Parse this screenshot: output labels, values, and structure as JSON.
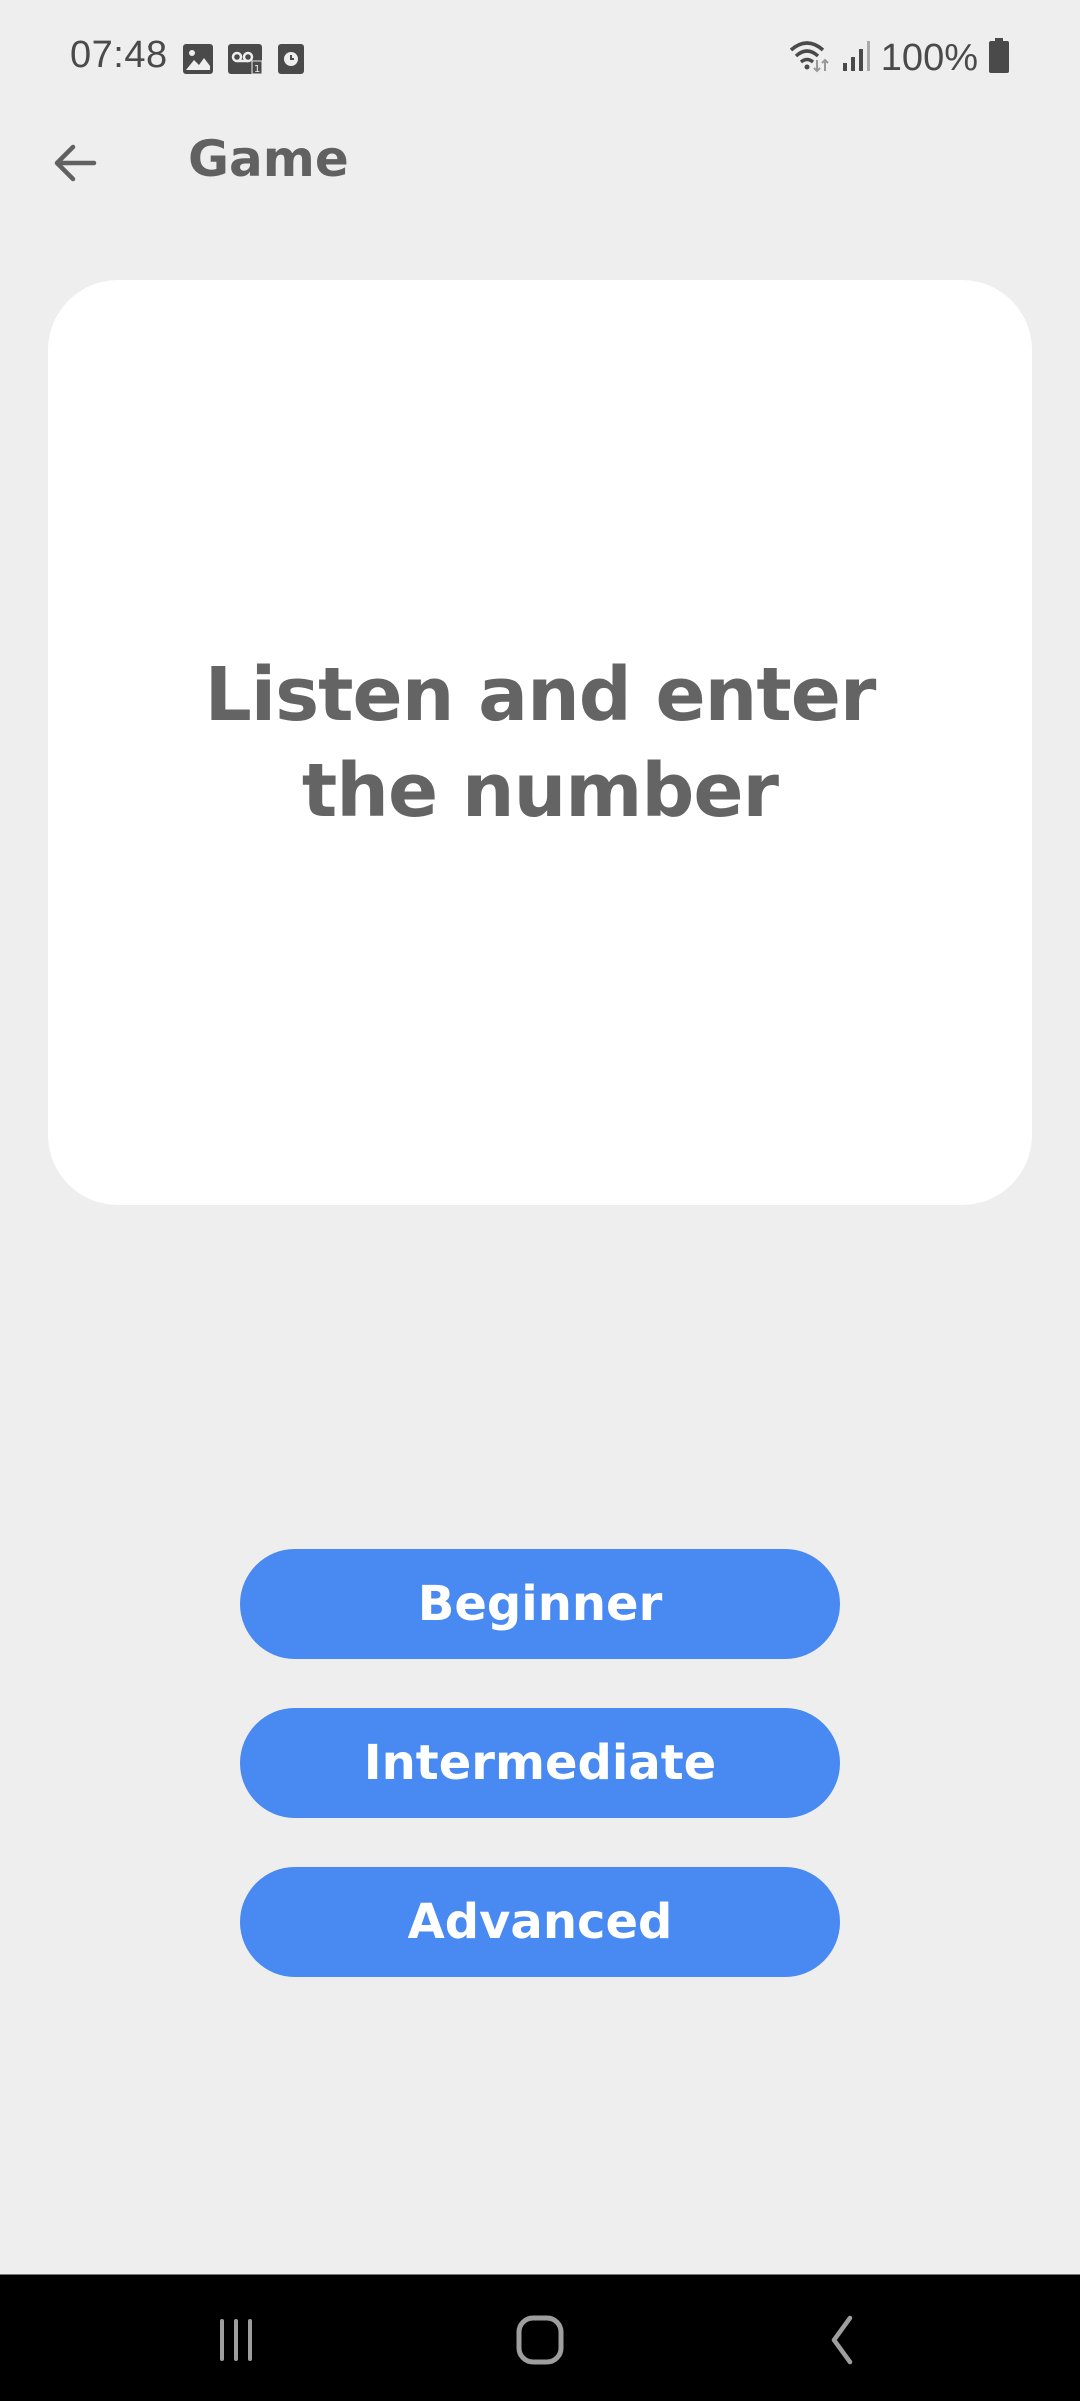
{
  "status_bar": {
    "time": "07:48",
    "notification_icons": [
      "image-icon",
      "voicemail-icon",
      "clock-icon"
    ],
    "voicemail_badge": "1",
    "battery_percent": "100%",
    "system_icons": [
      "wifi-icon",
      "signal-icon",
      "battery-icon"
    ]
  },
  "app_bar": {
    "title": "Game",
    "back_icon": "arrow-left-icon"
  },
  "card": {
    "instruction": "Listen and enter the number"
  },
  "levels": [
    {
      "label": "Beginner"
    },
    {
      "label": "Intermediate"
    },
    {
      "label": "Advanced"
    }
  ],
  "colors": {
    "background": "#eeeeee",
    "card": "#ffffff",
    "accent": "#4889f2",
    "text": "#616161"
  },
  "nav_bar": {
    "buttons": [
      "recent-apps",
      "home",
      "back"
    ]
  }
}
